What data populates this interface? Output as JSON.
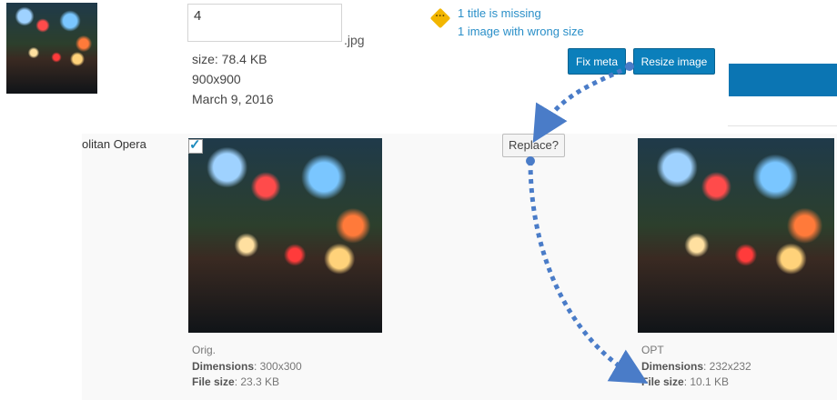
{
  "top": {
    "filename_value": "4",
    "extension": ".jpg",
    "size": "size: 78.4 KB",
    "dimensions": "900x900",
    "date": "March 9, 2016",
    "warnings": [
      "1 title is missing",
      "1 image with wrong size"
    ],
    "buttons": {
      "fix_meta": "Fix meta",
      "resize_image": "Resize image"
    }
  },
  "row": {
    "title": "olitan Opera",
    "checkbox_checked": true,
    "replace_button": "Replace?",
    "original": {
      "label": "Orig.",
      "dimensions_label": "Dimensions",
      "dimensions_value": ": 300x300",
      "filesize_label": "File size",
      "filesize_value": ": 23.3 KB"
    },
    "optimized": {
      "label": "OPT",
      "dimensions_label": "Dimensions",
      "dimensions_value": ": 232x232",
      "filesize_label": "File size",
      "filesize_value": ": 10.1 KB"
    }
  },
  "colors": {
    "accent": "#0b7fbb",
    "link": "#2a8fc8",
    "warning": "#f2b600",
    "arrow": "#4a7cc8"
  },
  "icons": {
    "warning": "warning-dots-icon",
    "check": "checkmark-icon"
  }
}
